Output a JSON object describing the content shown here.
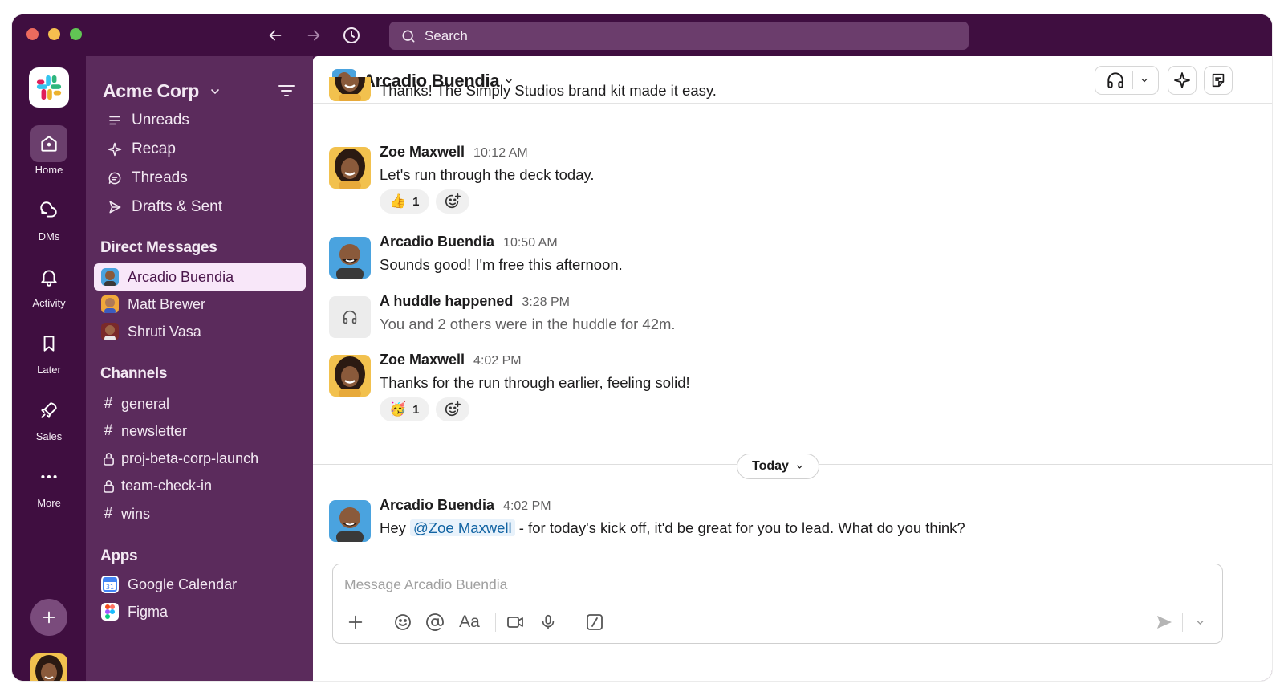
{
  "titlebar": {
    "search_placeholder": "Search"
  },
  "rail": {
    "items": [
      {
        "label": "Home",
        "icon": "home-icon"
      },
      {
        "label": "DMs",
        "icon": "dms-icon"
      },
      {
        "label": "Activity",
        "icon": "bell-icon"
      },
      {
        "label": "Later",
        "icon": "bookmark-icon"
      },
      {
        "label": "Sales",
        "icon": "rocket-icon"
      },
      {
        "label": "More",
        "icon": "more-icon"
      }
    ]
  },
  "sidebar": {
    "workspace": "Acme Corp",
    "nav": [
      {
        "label": "Unreads",
        "icon": "unreads-icon"
      },
      {
        "label": "Recap",
        "icon": "sparkle-icon"
      },
      {
        "label": "Threads",
        "icon": "threads-icon"
      },
      {
        "label": "Drafts & Sent",
        "icon": "send-icon"
      }
    ],
    "dm_header": "Direct Messages",
    "dms": [
      {
        "label": "Arcadio Buendia",
        "active": true
      },
      {
        "label": "Matt Brewer",
        "active": false
      },
      {
        "label": "Shruti Vasa",
        "active": false
      }
    ],
    "channels_header": "Channels",
    "channels": [
      {
        "label": "general",
        "private": false
      },
      {
        "label": "newsletter",
        "private": false
      },
      {
        "label": "proj-beta-corp-launch",
        "private": true
      },
      {
        "label": "team-check-in",
        "private": true
      },
      {
        "label": "wins",
        "private": false
      }
    ],
    "apps_header": "Apps",
    "apps": [
      {
        "label": "Google Calendar"
      },
      {
        "label": "Figma"
      }
    ]
  },
  "header": {
    "title": "Arcadio Buendia"
  },
  "messages": {
    "m0": {
      "text": "Thanks! The Simply Studios brand kit made it easy."
    },
    "m1": {
      "name": "Zoe Maxwell",
      "time": "10:12 AM",
      "text": "Let's run through the deck today.",
      "reaction_emoji": "👍",
      "reaction_count": "1"
    },
    "m2": {
      "name": "Arcadio Buendia",
      "time": "10:50 AM",
      "text": "Sounds good! I'm free this afternoon."
    },
    "m3": {
      "name": "A huddle happened",
      "time": "3:28 PM",
      "text": "You and 2 others were in the huddle for 42m."
    },
    "m4": {
      "name": "Zoe Maxwell",
      "time": "4:02 PM",
      "text": "Thanks for the run through earlier, feeling solid!",
      "reaction_emoji": "🥳",
      "reaction_count": "1"
    },
    "m5": {
      "name": "Arcadio Buendia",
      "time": "4:02 PM",
      "text_before": "Hey ",
      "mention": "@Zoe Maxwell",
      "text_after": " - for today's kick off, it'd be great for you to lead. What do you think?"
    }
  },
  "divider": {
    "label": "Today"
  },
  "composer": {
    "placeholder": "Message Arcadio Buendia",
    "format_label": "Aa"
  },
  "colors": {
    "aubergine": "#4a154b",
    "sidebar": "#5b2b5c",
    "mention_text": "#1264a3",
    "online": "#2bac76"
  }
}
